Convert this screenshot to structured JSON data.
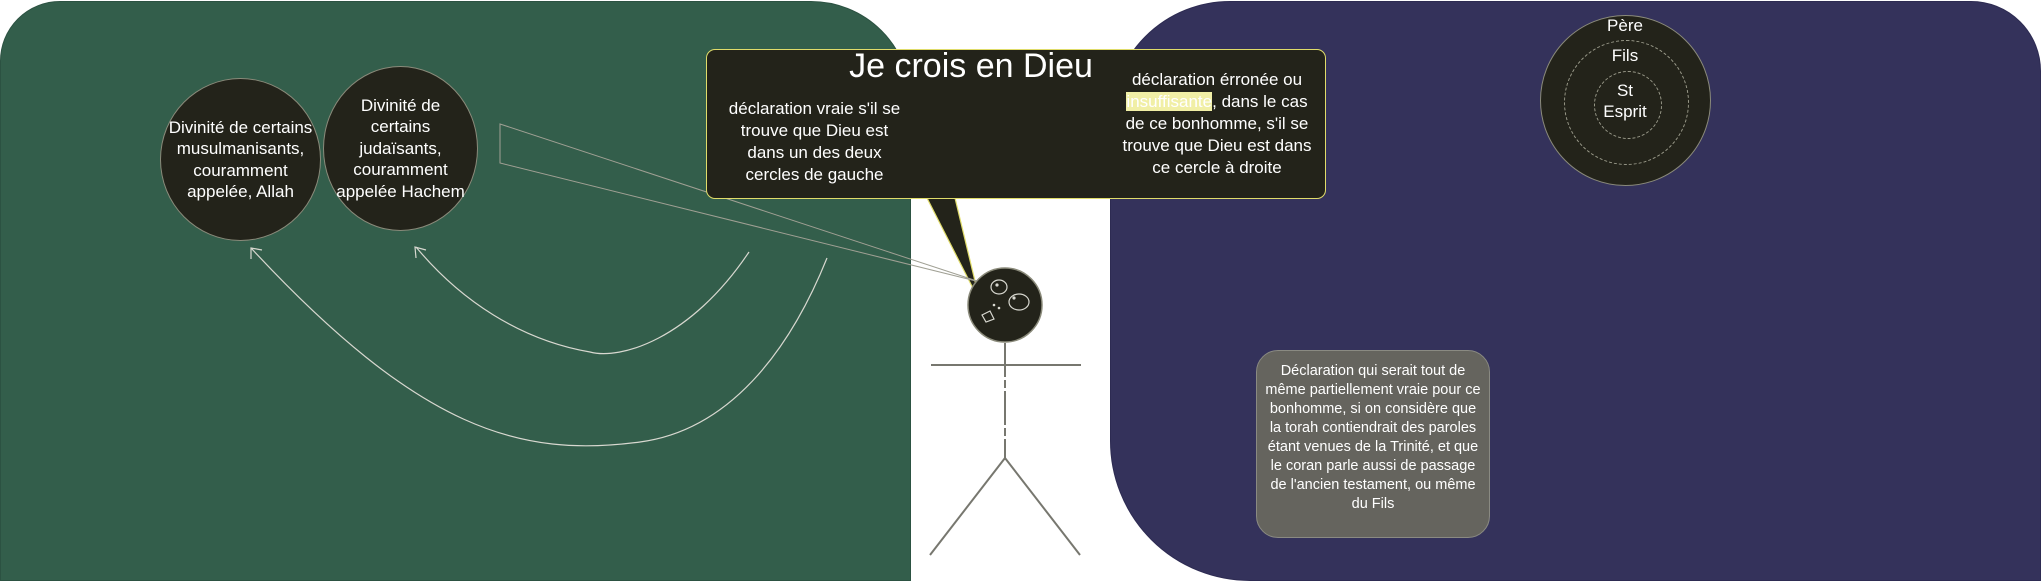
{
  "speech_bubble": {
    "title": "Je crois en Dieu",
    "true_statement": "déclaration vraie s'il se trouve que Dieu est dans un des deux cercles de gauche",
    "false_statement_before": "déclaration érronée ou ",
    "false_statement_highlight": "insuffisante",
    "false_statement_after": ", dans le cas de ce bonhomme, s'il se trouve que Dieu est dans ce cercle à droite"
  },
  "left_circles": {
    "muslim": "Divinité de certains musulmanisants, couramment appelée, Allah",
    "jewish": "Divinité de certains judaïsants, couramment appelée Hachem"
  },
  "trinity": {
    "father": "Père",
    "son": "Fils",
    "spirit_line1": "St",
    "spirit_line2": "Esprit"
  },
  "note": "Déclaration qui serait tout de même partiellement vraie pour ce bonhomme, si on considère que la torah contiendrait des paroles étant venues de la Trinité, et que le coran parle aussi de passage de l'ancien testament, ou même du Fils",
  "colors": {
    "left_panel": "#335e4b",
    "right_panel": "#34325b",
    "dark_fill": "#23231a",
    "bubble_border": "#e0dc6a",
    "highlight": "#f1efa6",
    "note_box": "#65645e"
  }
}
